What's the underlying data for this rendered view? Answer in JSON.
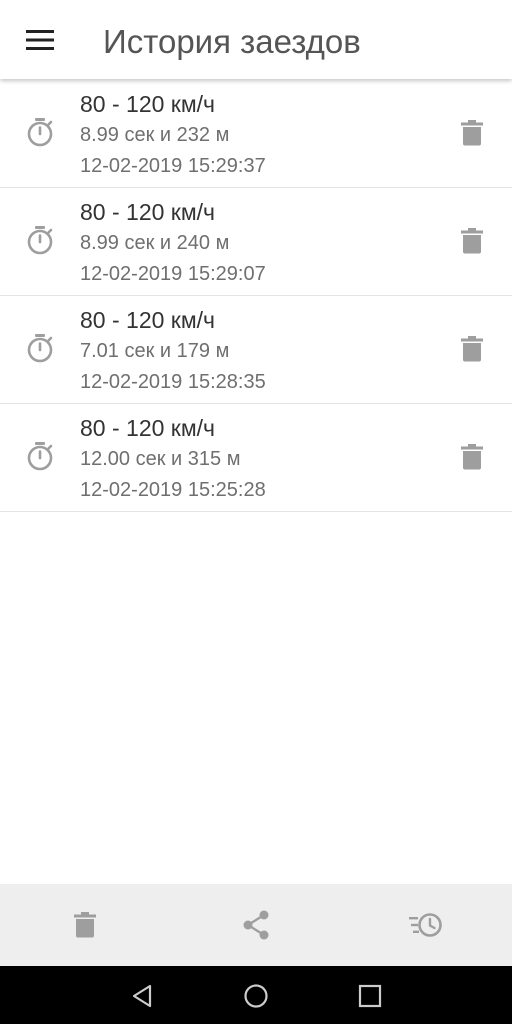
{
  "appbar": {
    "title": "История заездов",
    "menu_icon": "menu-icon"
  },
  "runs": [
    {
      "title": "80 - 120 км/ч",
      "result": "8.99 сек и 232 м",
      "datetime": "12-02-2019 15:29:37"
    },
    {
      "title": "80 - 120 км/ч",
      "result": "8.99 сек и 240 м",
      "datetime": "12-02-2019 15:29:07"
    },
    {
      "title": "80 - 120 км/ч",
      "result": "7.01 сек и 179 м",
      "datetime": "12-02-2019 15:28:35"
    },
    {
      "title": "80 - 120 км/ч",
      "result": "12.00 сек и 315 м",
      "datetime": "12-02-2019 15:25:28"
    }
  ],
  "row_icons": {
    "leading": "stopwatch-icon",
    "trailing": "trash-icon"
  },
  "bottom_bar": {
    "buttons": [
      "trash-icon",
      "share-icon",
      "history-icon"
    ]
  },
  "system_nav": {
    "buttons": [
      "back-icon",
      "home-icon",
      "recents-icon"
    ]
  },
  "colors": {
    "appbar_background": "#ffffff",
    "title_text": "#555555",
    "icon_gray": "#9e9e9e",
    "bottom_bar_background": "#eeeeee",
    "system_nav_background": "#000000"
  }
}
